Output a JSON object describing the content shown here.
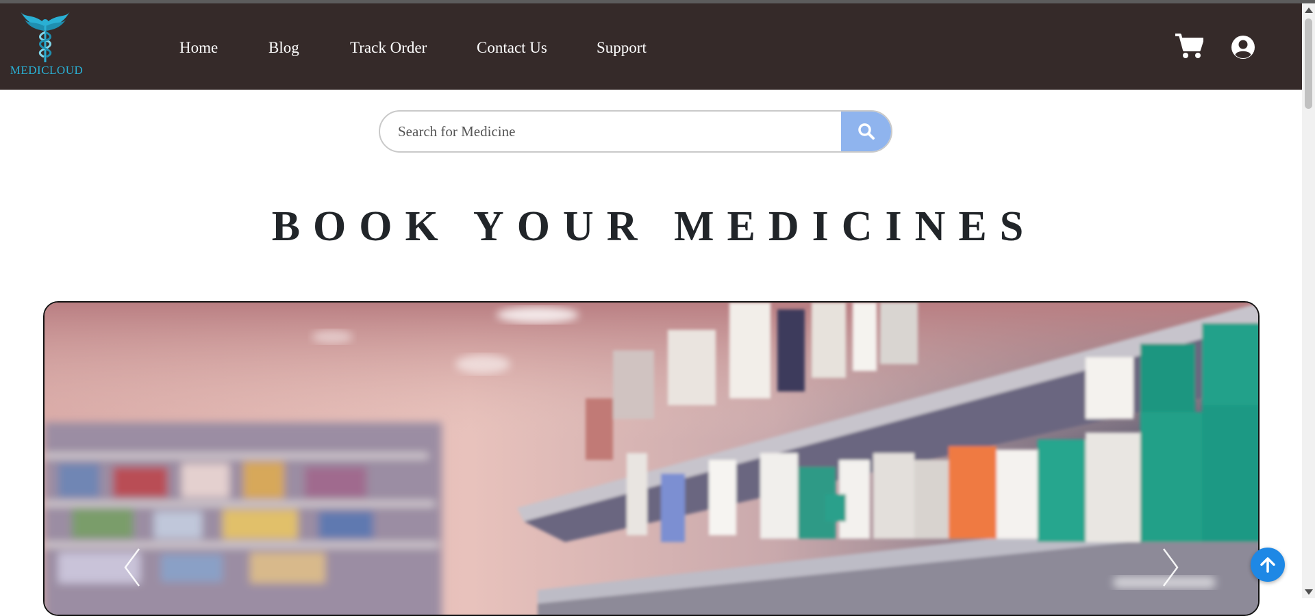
{
  "brand": {
    "name": "MEDICLOUD",
    "logo_icon": "caduceus-icon",
    "color": "#2ab0d4"
  },
  "nav": {
    "links": [
      {
        "label": "Home"
      },
      {
        "label": "Blog"
      },
      {
        "label": "Track Order"
      },
      {
        "label": "Contact Us"
      },
      {
        "label": "Support"
      }
    ],
    "icons": [
      "cart-icon",
      "user-circle-icon"
    ],
    "background": "#352a29"
  },
  "search": {
    "placeholder": "Search for Medicine",
    "value": "",
    "button_icon": "search-icon",
    "button_color": "#8fb4ee"
  },
  "hero": {
    "title": "BOOK YOUR MEDICINES"
  },
  "carousel": {
    "slide_image": "pharmacy-shelves-image",
    "prev_icon": "chevron-left-icon",
    "next_icon": "chevron-right-icon"
  },
  "scroll_top": {
    "icon": "arrow-up-icon",
    "color": "#1e88e5"
  }
}
